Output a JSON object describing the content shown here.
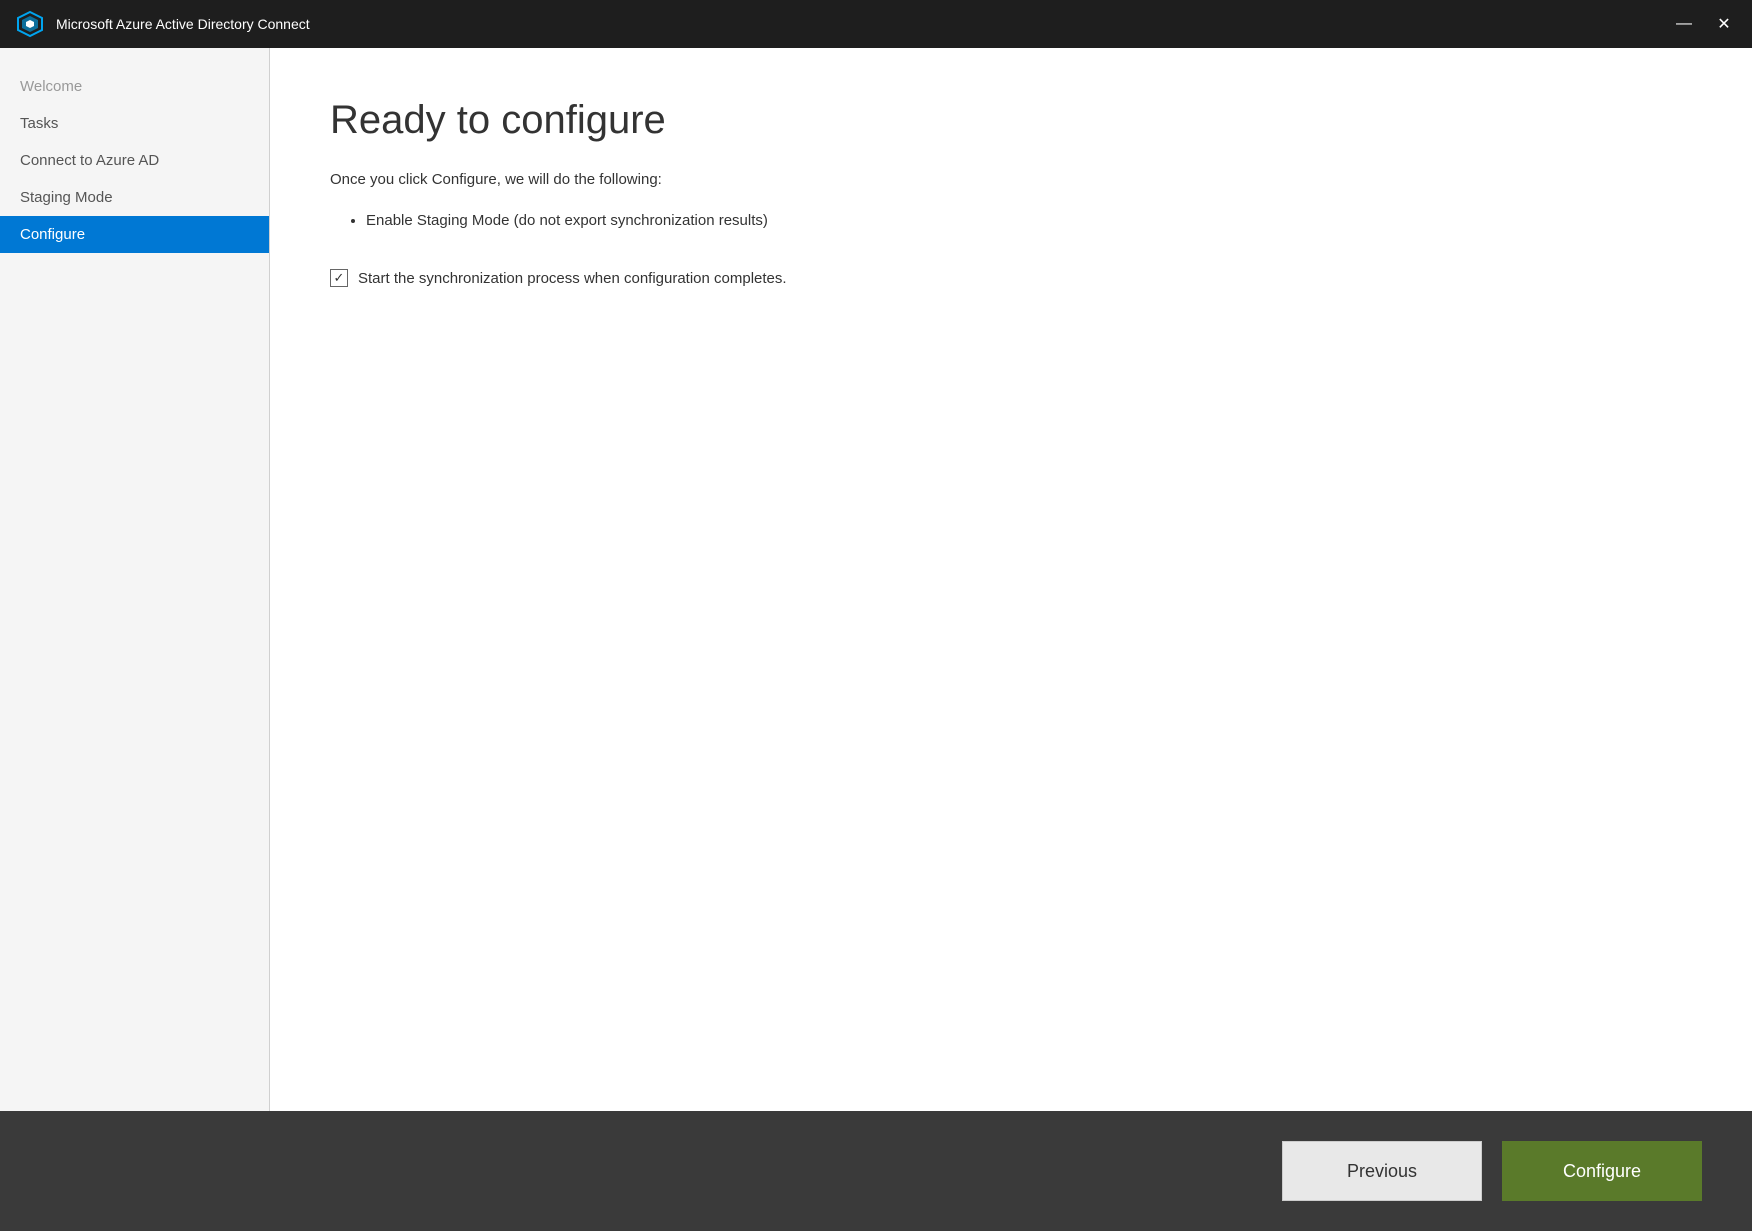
{
  "titlebar": {
    "title": "Microsoft Azure Active Directory Connect",
    "minimize_label": "minimize",
    "close_label": "close"
  },
  "sidebar": {
    "items": [
      {
        "id": "welcome",
        "label": "Welcome",
        "state": "muted"
      },
      {
        "id": "tasks",
        "label": "Tasks",
        "state": "normal"
      },
      {
        "id": "connect-azure-ad",
        "label": "Connect to Azure AD",
        "state": "normal"
      },
      {
        "id": "staging-mode",
        "label": "Staging Mode",
        "state": "normal"
      },
      {
        "id": "configure",
        "label": "Configure",
        "state": "active"
      }
    ]
  },
  "main": {
    "page_title": "Ready to configure",
    "description": "Once you click Configure, we will do the following:",
    "bullets": [
      "Enable Staging Mode (do not export synchronization results)"
    ],
    "checkbox": {
      "checked": true,
      "label": "Start the synchronization process when configuration completes."
    }
  },
  "footer": {
    "previous_label": "Previous",
    "configure_label": "Configure"
  }
}
